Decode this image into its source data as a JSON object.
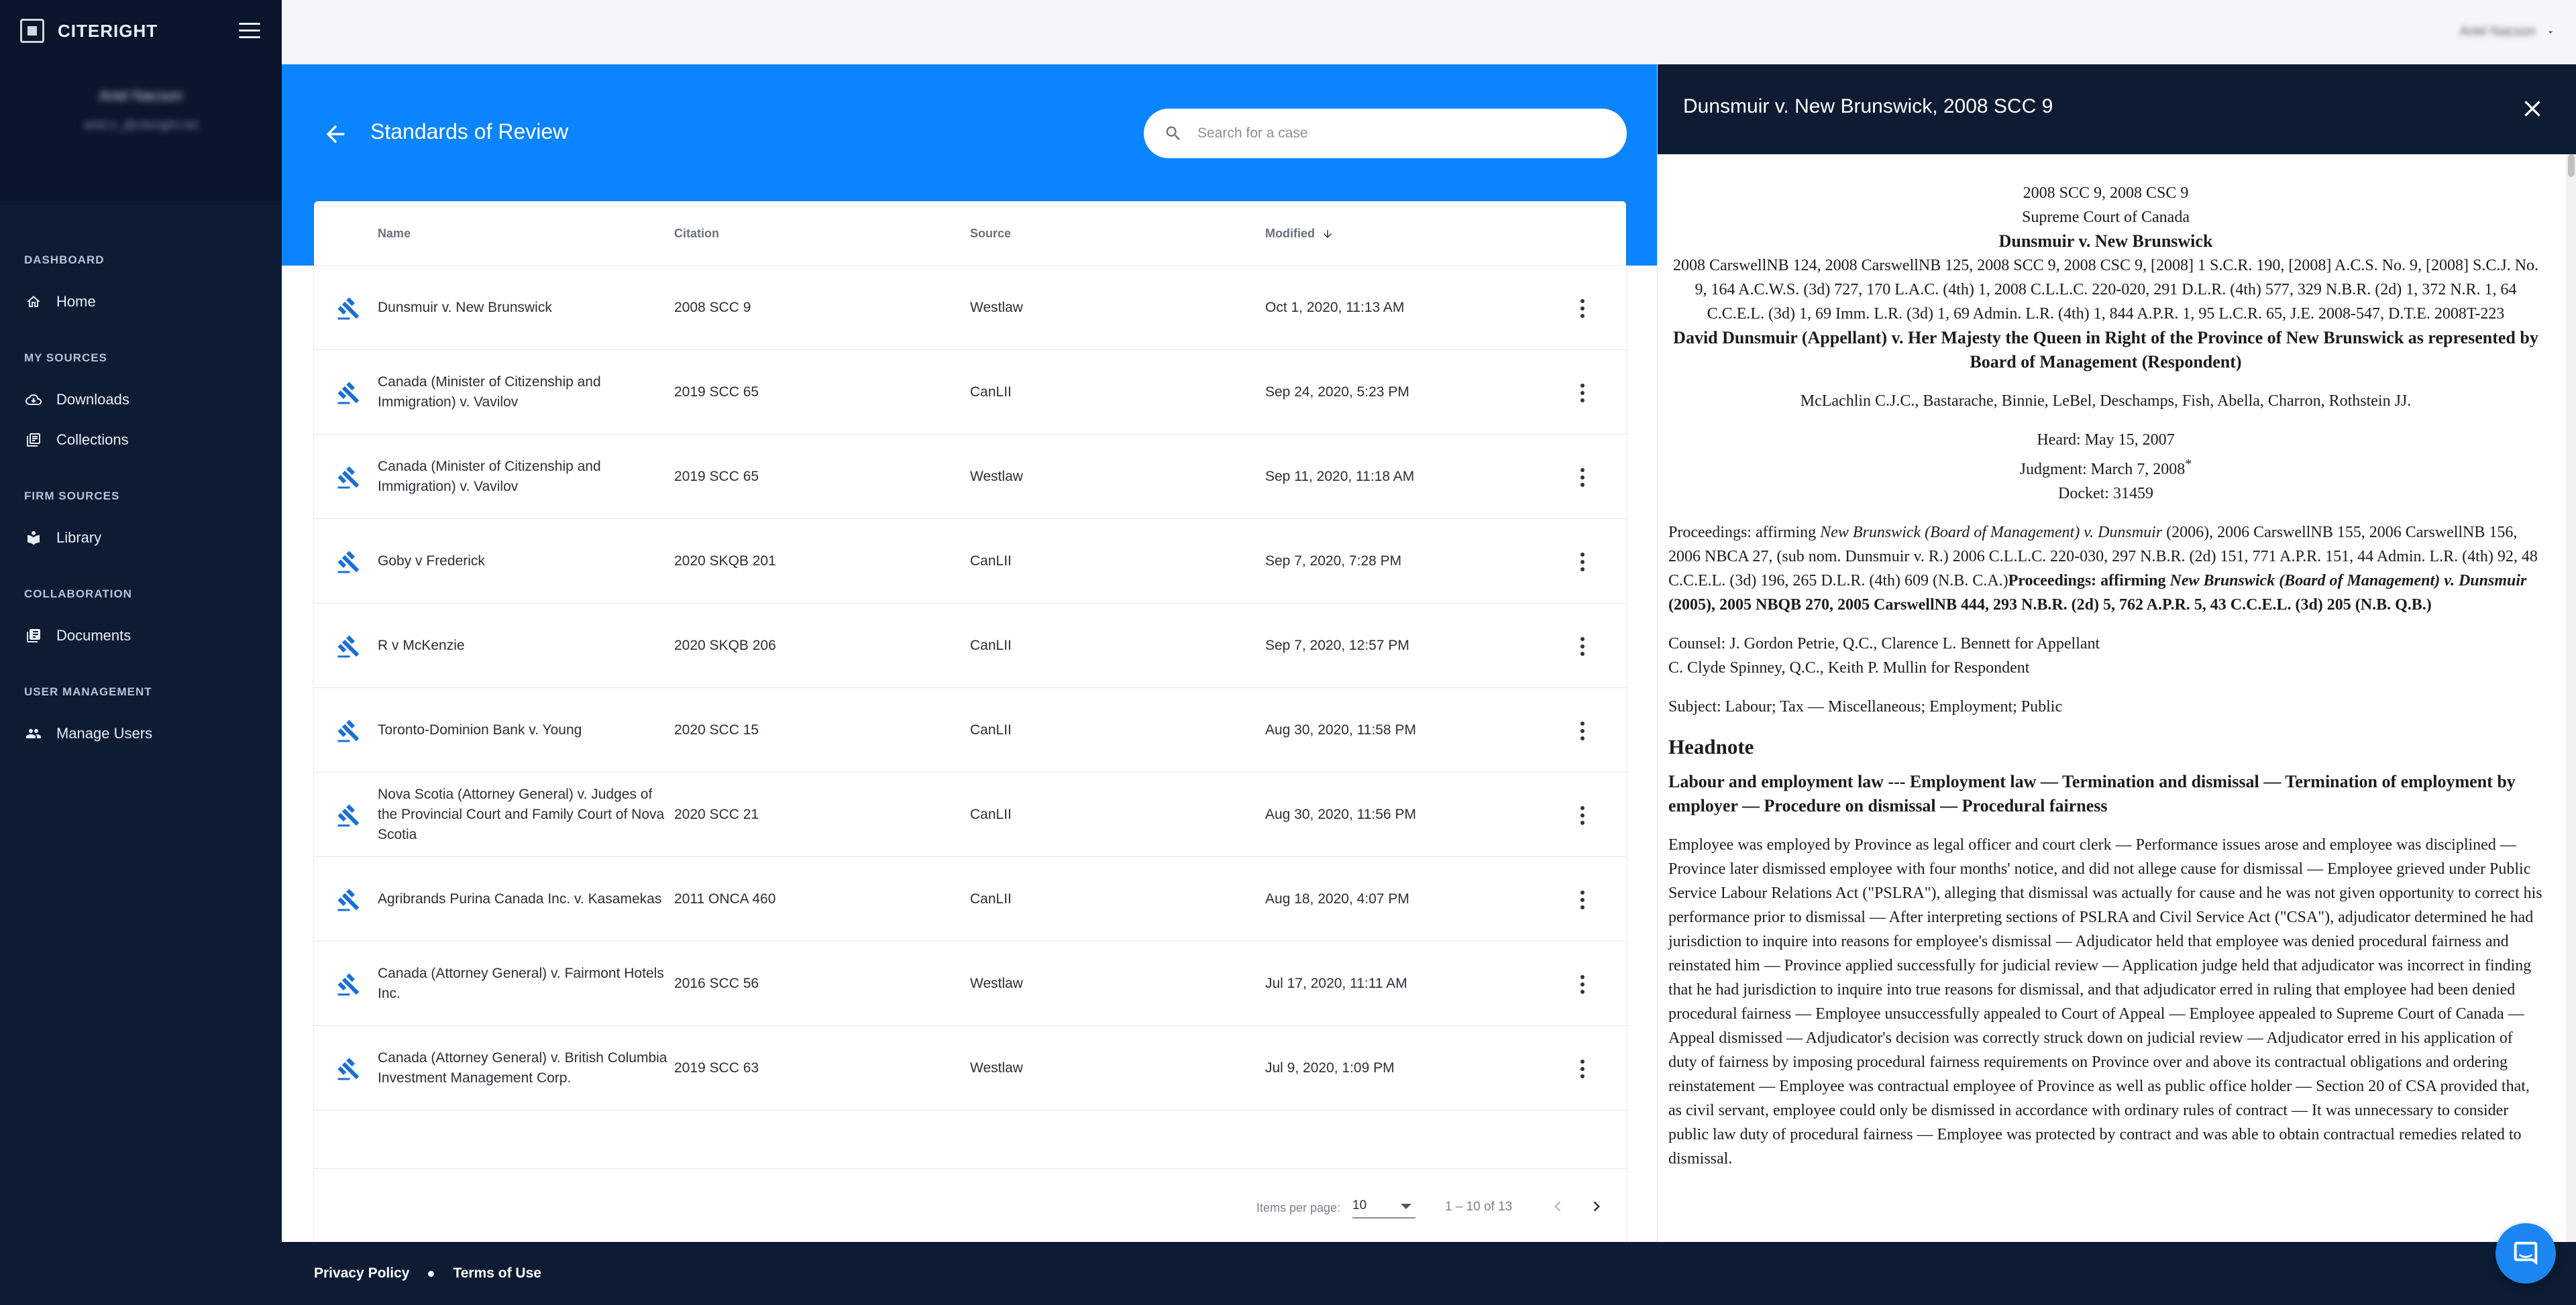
{
  "brand": {
    "name": "CITERIGHT"
  },
  "profile": {
    "name": "Ariel Nacson",
    "email": "ariel.n_@citeright.net"
  },
  "topbar": {
    "user": "Ariel Nacson"
  },
  "nav": {
    "sections": [
      {
        "title": "DASHBOARD",
        "items": [
          {
            "label": "Home",
            "icon": "home-icon"
          }
        ]
      },
      {
        "title": "MY SOURCES",
        "items": [
          {
            "label": "Downloads",
            "icon": "cloud-download-icon"
          },
          {
            "label": "Collections",
            "icon": "collections-icon"
          }
        ]
      },
      {
        "title": "FIRM SOURCES",
        "items": [
          {
            "label": "Library",
            "icon": "library-icon"
          }
        ]
      },
      {
        "title": "COLLABORATION",
        "items": [
          {
            "label": "Documents",
            "icon": "documents-icon"
          }
        ]
      },
      {
        "title": "USER MANAGEMENT",
        "items": [
          {
            "label": "Manage Users",
            "icon": "users-icon"
          }
        ]
      }
    ]
  },
  "page": {
    "title": "Standards of Review"
  },
  "search": {
    "placeholder": "Search for a case",
    "value": ""
  },
  "table": {
    "headers": {
      "name": "Name",
      "citation": "Citation",
      "source": "Source",
      "modified": "Modified"
    },
    "rows": [
      {
        "name": "Dunsmuir v. New Brunswick",
        "citation": "2008 SCC 9",
        "source": "Westlaw",
        "modified": "Oct 1, 2020, 11:13 AM"
      },
      {
        "name": "Canada (Minister of Citizenship and Immigration) v. Vavilov",
        "citation": "2019 SCC 65",
        "source": "CanLII",
        "modified": "Sep 24, 2020, 5:23 PM"
      },
      {
        "name": "Canada (Minister of Citizenship and Immigration) v. Vavilov",
        "citation": "2019 SCC 65",
        "source": "Westlaw",
        "modified": "Sep 11, 2020, 11:18 AM"
      },
      {
        "name": "Goby v Frederick",
        "citation": "2020 SKQB 201",
        "source": "CanLII",
        "modified": "Sep 7, 2020, 7:28 PM"
      },
      {
        "name": "R v McKenzie",
        "citation": "2020 SKQB 206",
        "source": "CanLII",
        "modified": "Sep 7, 2020, 12:57 PM"
      },
      {
        "name": "Toronto-Dominion Bank v. Young",
        "citation": "2020 SCC 15",
        "source": "CanLII",
        "modified": "Aug 30, 2020, 11:58 PM"
      },
      {
        "name": "Nova Scotia (Attorney General) v. Judges of the Provincial Court and Family Court of Nova Scotia",
        "citation": "2020 SCC 21",
        "source": "CanLII",
        "modified": "Aug 30, 2020, 11:56 PM"
      },
      {
        "name": "Agribrands Purina Canada Inc. v. Kasamekas",
        "citation": "2011 ONCA 460",
        "source": "CanLII",
        "modified": "Aug 18, 2020, 4:07 PM"
      },
      {
        "name": "Canada (Attorney General) v. Fairmont Hotels Inc.",
        "citation": "2016 SCC 56",
        "source": "Westlaw",
        "modified": "Jul 17, 2020, 11:11 AM"
      },
      {
        "name": "Canada (Attorney General) v. British Columbia Investment Management Corp.",
        "citation": "2019 SCC 63",
        "source": "Westlaw",
        "modified": "Jul 9, 2020, 1:09 PM"
      }
    ]
  },
  "paginator": {
    "label": "Items per page:",
    "page_size": "10",
    "range": "1 – 10 of 13"
  },
  "footer": {
    "privacy": "Privacy Policy",
    "terms": "Terms of Use"
  },
  "doc": {
    "title": "Dunsmuir v. New Brunswick, 2008 SCC 9",
    "cite1": "2008 SCC 9, 2008 CSC 9",
    "court": "Supreme Court of Canada",
    "case": "Dunsmuir v. New Brunswick",
    "citations": "2008 CarswellNB 124, 2008 CarswellNB 125, 2008 SCC 9, 2008 CSC 9, [2008] 1 S.C.R. 190, [2008] A.C.S. No. 9, [2008] S.C.J. No. 9, 164 A.C.W.S. (3d) 727, 170 L.A.C. (4th) 1, 2008 C.L.L.C. 220-020, 291 D.L.R. (4th) 577, 329 N.B.R. (2d) 1, 372 N.R. 1, 64 C.C.E.L. (3d) 1, 69 Imm. L.R. (3d) 1, 69 Admin. L.R. (4th) 1, 844 A.P.R. 1, 95 L.C.R. 65, J.E. 2008-547, D.T.E. 2008T-223",
    "parties": "David Dunsmuir (Appellant) v. Her Majesty the Queen in Right of the Province of New Brunswick as represented by Board of Management (Respondent)",
    "judges": "McLachlin C.J.C., Bastarache, Binnie, LeBel, Deschamps, Fish, Abella, Charron, Rothstein JJ.",
    "heard": "Heard: May 15, 2007",
    "judgment": "Judgment: March 7, 2008",
    "judgment_mark": "*",
    "docket": "Docket: 31459",
    "proc_1": "Proceedings: affirming ",
    "proc_2": "New Brunswick (Board of Management) v. Dunsmuir",
    "proc_3": " (2006), 2006 CarswellNB 155, 2006 CarswellNB 156, 2006 NBCA 27, (sub nom. Dunsmuir v. R.) 2006 C.L.L.C. 220-030, 297 N.B.R. (2d) 151, 771 A.P.R. 151, 44 Admin. L.R. (4th) 92, 48 C.C.E.L. (3d) 196, 265 D.L.R. (4th) 609 (N.B. C.A.)",
    "proc_4": "Proceedings: affirming ",
    "proc_5": "New Brunswick (Board of Management) v. Dunsmuir",
    "proc_6": " (2005), 2005 NBQB 270, 2005 CarswellNB 444, 293 N.B.R. (2d) 5, 762 A.P.R. 5, 43 C.C.E.L. (3d) 205 (N.B. Q.B.)",
    "counsel_1": "Counsel: J. Gordon Petrie, Q.C., Clarence L. Bennett for Appellant",
    "counsel_2": "C. Clyde Spinney, Q.C., Keith P. Mullin for Respondent",
    "subject": "Subject: Labour; Tax — Miscellaneous; Employment; Public",
    "headnote_title": "Headnote",
    "headnote_sub": "Labour and employment law --- Employment law — Termination and dismissal — Termination of employment by employer — Procedure on dismissal — Procedural fairness",
    "headnote_body": "Employee was employed by Province as legal officer and court clerk — Performance issues arose and employee was disciplined — Province later dismissed employee with four months' notice, and did not allege cause for dismissal — Employee grieved under Public Service Labour Relations Act (\"PSLRA\"), alleging that dismissal was actually for cause and he was not given opportunity to correct his performance prior to dismissal — After interpreting sections of PSLRA and Civil Service Act (\"CSA\"), adjudicator determined he had jurisdiction to inquire into reasons for employee's dismissal — Adjudicator held that employee was denied procedural fairness and reinstated him — Province applied successfully for judicial review — Application judge held that adjudicator was incorrect in finding that he had jurisdiction to inquire into true reasons for dismissal, and that adjudicator erred in ruling that employee had been denied procedural fairness — Employee unsuccessfully appealed to Court of Appeal — Employee appealed to Supreme Court of Canada — Appeal dismissed — Adjudicator's decision was correctly struck down on judicial review — Adjudicator erred in his application of duty of fairness by imposing procedural fairness requirements on Province over and above its contractual obligations and ordering reinstatement — Employee was contractual employee of Province as well as public office holder — Section 20 of CSA provided that, as civil servant, employee could only be dismissed in accordance with ordinary rules of contract — It was unnecessary to consider public law duty of procedural fairness — Employee was protected by contract and was able to obtain contractual remedies related to dismissal."
  }
}
